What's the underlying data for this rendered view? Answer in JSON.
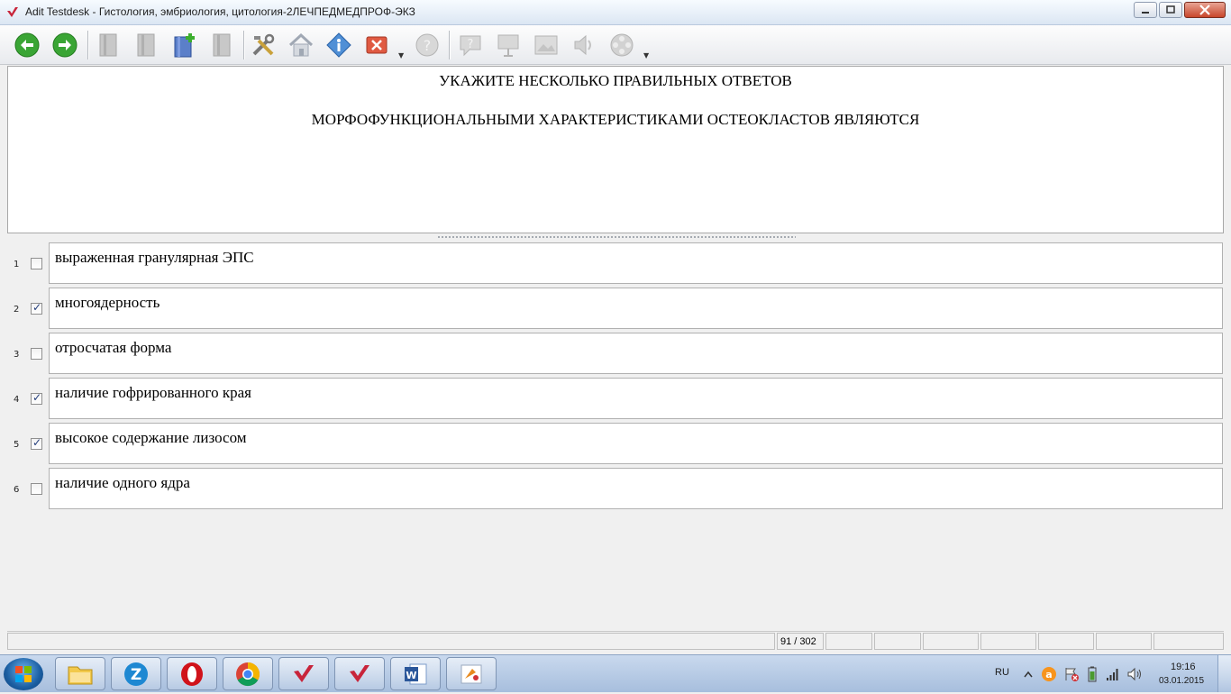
{
  "window": {
    "title": "Adit Testdesk - Гистология, эмбриология, цитология-2ЛЕЧПЕДМЕДПРОФ-ЭКЗ"
  },
  "toolbar": {
    "buttons": [
      "back",
      "forward",
      "save-disabled",
      "save-as-disabled",
      "add-page",
      "page-disabled",
      "settings",
      "home",
      "info",
      "close-test",
      "help-disabled",
      "hint-disabled",
      "presentation-disabled",
      "image-disabled",
      "sound-disabled",
      "video-disabled"
    ]
  },
  "question": {
    "instruction": "УКАЖИТЕ НЕСКОЛЬКО ПРАВИЛЬНЫХ ОТВЕТОВ",
    "text": "МОРФОФУНКЦИОНАЛЬНЫМИ ХАРАКТЕРИСТИКАМИ ОСТЕОКЛАСТОВ ЯВЛЯЮТСЯ"
  },
  "answers": [
    {
      "num": "1",
      "text": "выраженная гранулярная ЭПС",
      "checked": false
    },
    {
      "num": "2",
      "text": "многоядерность",
      "checked": true
    },
    {
      "num": "3",
      "text": "отросчатая форма",
      "checked": false
    },
    {
      "num": "4",
      "text": "наличие гофрированного края",
      "checked": true
    },
    {
      "num": "5",
      "text": "высокое содержание лизосом",
      "checked": true
    },
    {
      "num": "6",
      "text": "наличие одного ядра",
      "checked": false
    }
  ],
  "status": {
    "progress": "91 / 302"
  },
  "taskbar": {
    "apps": [
      "explorer",
      "zona",
      "opera",
      "chrome",
      "adit-testdesk-1",
      "adit-testdesk-2",
      "word",
      "paint"
    ]
  },
  "tray": {
    "lang": "RU",
    "time": "19:16",
    "date": "03.01.2015"
  },
  "colors": {
    "accent": "#1b5fa3",
    "check": "#243e7c"
  }
}
